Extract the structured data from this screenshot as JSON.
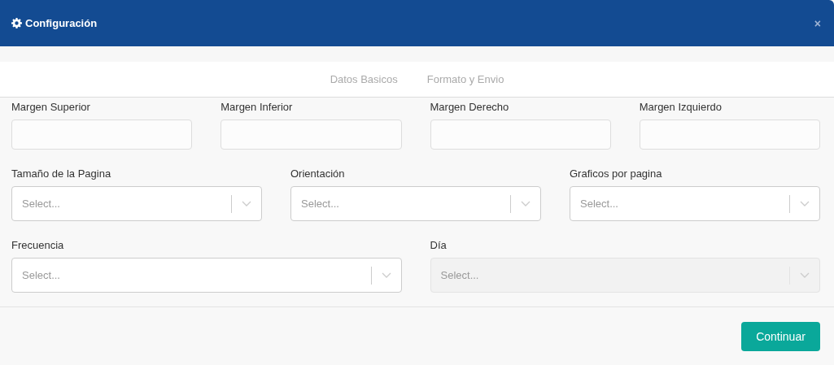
{
  "dialog": {
    "title": "Configuración",
    "close": "×"
  },
  "tabs": [
    {
      "label": "Datos Basicos",
      "selected": false
    },
    {
      "label": "Formato y Envio",
      "selected": false
    }
  ],
  "margins": [
    {
      "label": "Margen Superior"
    },
    {
      "label": "Margen Inferior"
    },
    {
      "label": "Margen Derecho"
    },
    {
      "label": "Margen Izquierdo"
    }
  ],
  "selects_row_1": [
    {
      "label": "Tamaño de la Pagina",
      "placeholder": "Select...",
      "disabled": false
    },
    {
      "label": "Orientación",
      "placeholder": "Select...",
      "disabled": false
    },
    {
      "label": "Graficos por pagina",
      "placeholder": "Select...",
      "disabled": false
    }
  ],
  "selects_row_2": [
    {
      "label": "Frecuencia",
      "placeholder": "Select...",
      "disabled": false
    },
    {
      "label": "Día",
      "placeholder": "Select...",
      "disabled": true
    }
  ],
  "footer": {
    "button": "Continuar"
  }
}
